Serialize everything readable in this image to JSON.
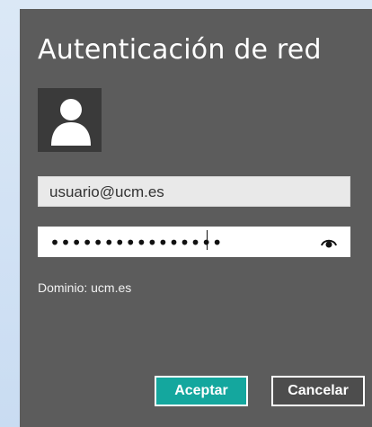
{
  "dialog": {
    "title": "Autenticación de red",
    "avatar_icon": "user-silhouette-icon",
    "username_value": "usuario@ucm.es",
    "password_masked": "••••••••••••••••",
    "show_password_icon": "eye-icon",
    "domain_text": "Dominio: ucm.es",
    "accept_label": "Aceptar",
    "cancel_label": "Cancelar"
  },
  "colors": {
    "dialog_bg": "#5c5c5c",
    "accent": "#14a79e",
    "desktop_bg": "#d2e2f4"
  }
}
